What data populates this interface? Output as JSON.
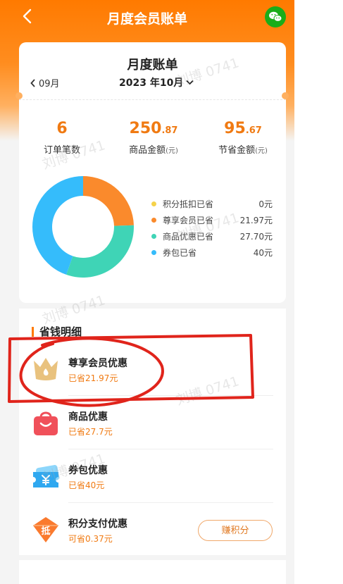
{
  "navbar": {
    "title": "月度会员账单"
  },
  "bill": {
    "title": "月度账单",
    "prev_month": "09月",
    "current_month": "2023 年10月"
  },
  "stats": [
    {
      "int": "6",
      "frac": "",
      "label": "订单笔数",
      "unit": ""
    },
    {
      "int": "250",
      "frac": ".87",
      "label": "商品金额",
      "unit": "(元)"
    },
    {
      "int": "95",
      "frac": ".67",
      "label": "节省金额",
      "unit": "(元)"
    }
  ],
  "chart_data": {
    "type": "pie",
    "donut": true,
    "categories": [
      "积分抵扣已省",
      "尊享会员已省",
      "商品优惠已省",
      "券包已省"
    ],
    "values": [
      0,
      21.97,
      27.7,
      40
    ],
    "colors": [
      "#f5d24a",
      "#fa8a2c",
      "#3fd4b6",
      "#35bcfb"
    ]
  },
  "legend": [
    {
      "label": "积分抵扣已省",
      "value": "0元",
      "color": "#f5d24a"
    },
    {
      "label": "尊享会员已省",
      "value": "21.97元",
      "color": "#fa8a2c"
    },
    {
      "label": "商品优惠已省",
      "value": "27.70元",
      "color": "#3fd4b6"
    },
    {
      "label": "券包已省",
      "value": "40元",
      "color": "#35bcfb"
    }
  ],
  "savings": {
    "title": "省钱明细",
    "items": [
      {
        "name": "尊享会员优惠",
        "sub": "已省21.97元",
        "icon": "crown-icon"
      },
      {
        "name": "商品优惠",
        "sub": "已省27.7元",
        "icon": "shopping-bag-icon"
      },
      {
        "name": "券包优惠",
        "sub": "已省40元",
        "icon": "yen-ticket-icon"
      },
      {
        "name": "积分支付优惠",
        "sub": "可省0.37元",
        "icon": "di-points-icon"
      }
    ],
    "earn_button": "赚积分"
  },
  "watermark": "刘博 0741",
  "colors": {
    "accent": "#ff7a00",
    "highlight_circle": "#e0241b"
  }
}
